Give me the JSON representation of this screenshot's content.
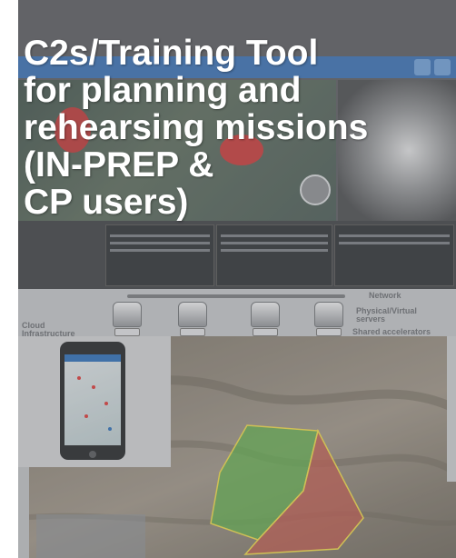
{
  "title": {
    "lines": [
      "C2s/Training Tool",
      "for planning and",
      "rehearsing missions",
      "(IN-PREP &",
      "CP users)"
    ]
  },
  "diagram": {
    "left_label": "Cloud\nInfrastructure",
    "network_label": "Network",
    "servers_label": "Physical/Virtual\nservers",
    "accelerators_label": "Shared accelerators"
  },
  "colors": {
    "app_header": "#3a6fb0",
    "zone_green": "#5cae4a",
    "zone_red": "#c0544a",
    "title_text": "#ffffff"
  },
  "icons": {
    "drone_marker": "drone-icon",
    "server": "server-icon",
    "phone": "smartphone-icon"
  }
}
